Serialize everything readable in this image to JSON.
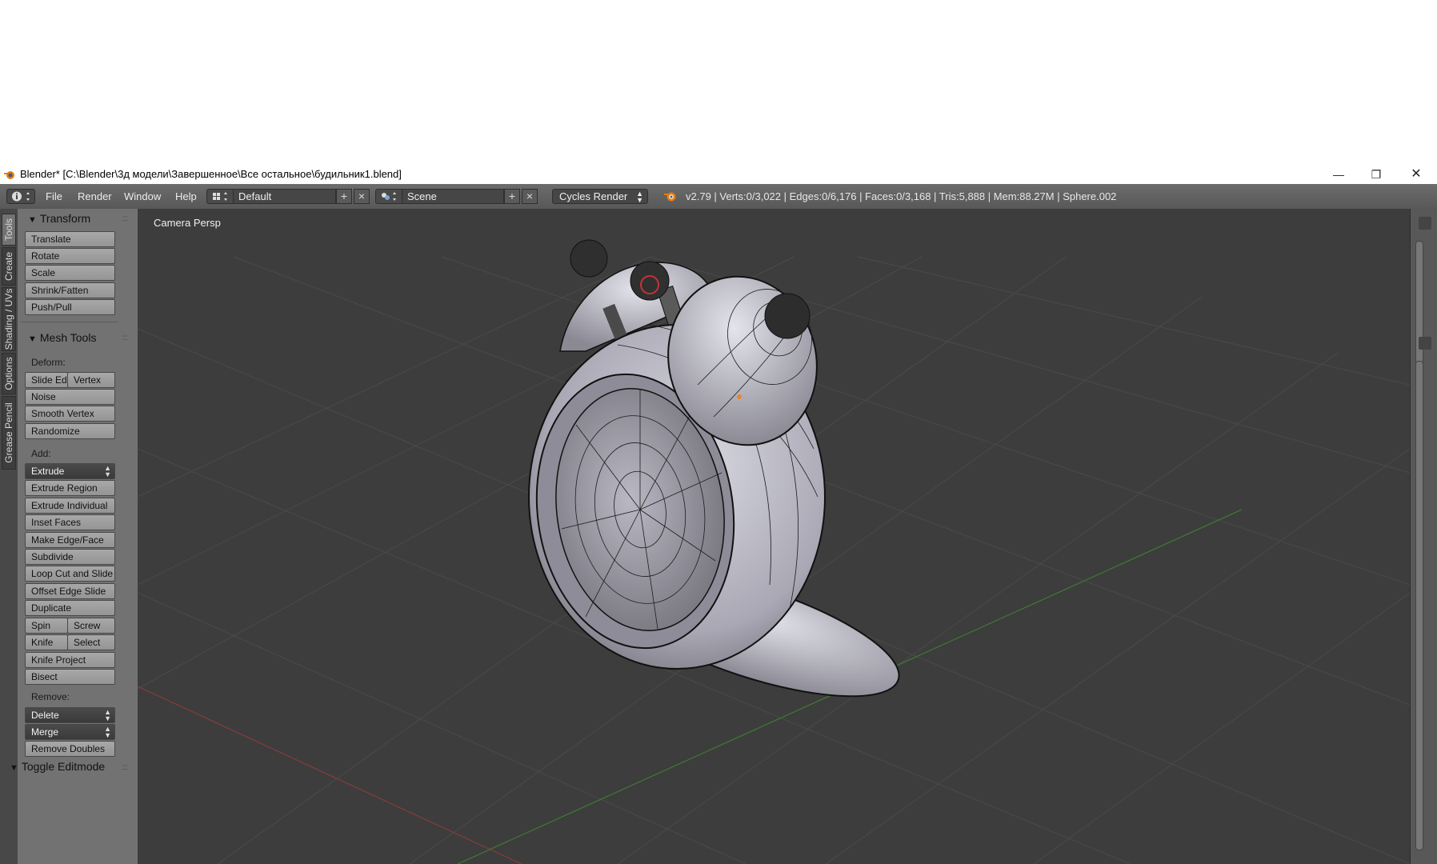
{
  "window": {
    "title": "Blender* [C:\\Blender\\3д модели\\Завершенное\\Все остальное\\будильник1.blend]",
    "minimize_icon": "minimize-icon",
    "maximize_icon": "restore-icon",
    "close_icon": "close-icon"
  },
  "header": {
    "menus": [
      "File",
      "Render",
      "Window",
      "Help"
    ],
    "layout": "Default",
    "scene": "Scene",
    "render_engine": "Cycles Render",
    "stats": "v2.79 | Verts:0/3,022 | Edges:0/6,176 | Faces:0/3,168 | Tris:5,888 | Mem:88.27M | Sphere.002"
  },
  "tabs": [
    "Tools",
    "Create",
    "Shading / UVs",
    "Options",
    "Grease Pencil"
  ],
  "transform": {
    "title": "Transform",
    "buttons": [
      "Translate",
      "Rotate",
      "Scale",
      "Shrink/Fatten",
      "Push/Pull"
    ]
  },
  "mesh_tools": {
    "title": "Mesh Tools",
    "deform_label": "Deform:",
    "slide_edge": "Slide Ed",
    "vertex": "Vertex",
    "noise": "Noise",
    "smooth_vertex": "Smooth Vertex",
    "randomize": "Randomize",
    "add_label": "Add:",
    "extrude": "Extrude",
    "extrude_region": "Extrude Region",
    "extrude_individual": "Extrude Individual",
    "inset_faces": "Inset Faces",
    "make_edge_face": "Make Edge/Face",
    "subdivide": "Subdivide",
    "loop_cut": "Loop Cut and Slide",
    "offset_edge": "Offset Edge Slide",
    "duplicate": "Duplicate",
    "spin": "Spin",
    "screw": "Screw",
    "knife": "Knife",
    "select": "Select",
    "knife_project": "Knife Project",
    "bisect": "Bisect",
    "remove_label": "Remove:",
    "delete": "Delete",
    "merge": "Merge",
    "remove_doubles": "Remove Doubles"
  },
  "toggle_editmode": {
    "title": "Toggle Editmode"
  },
  "viewport": {
    "label": "Camera Persp"
  }
}
